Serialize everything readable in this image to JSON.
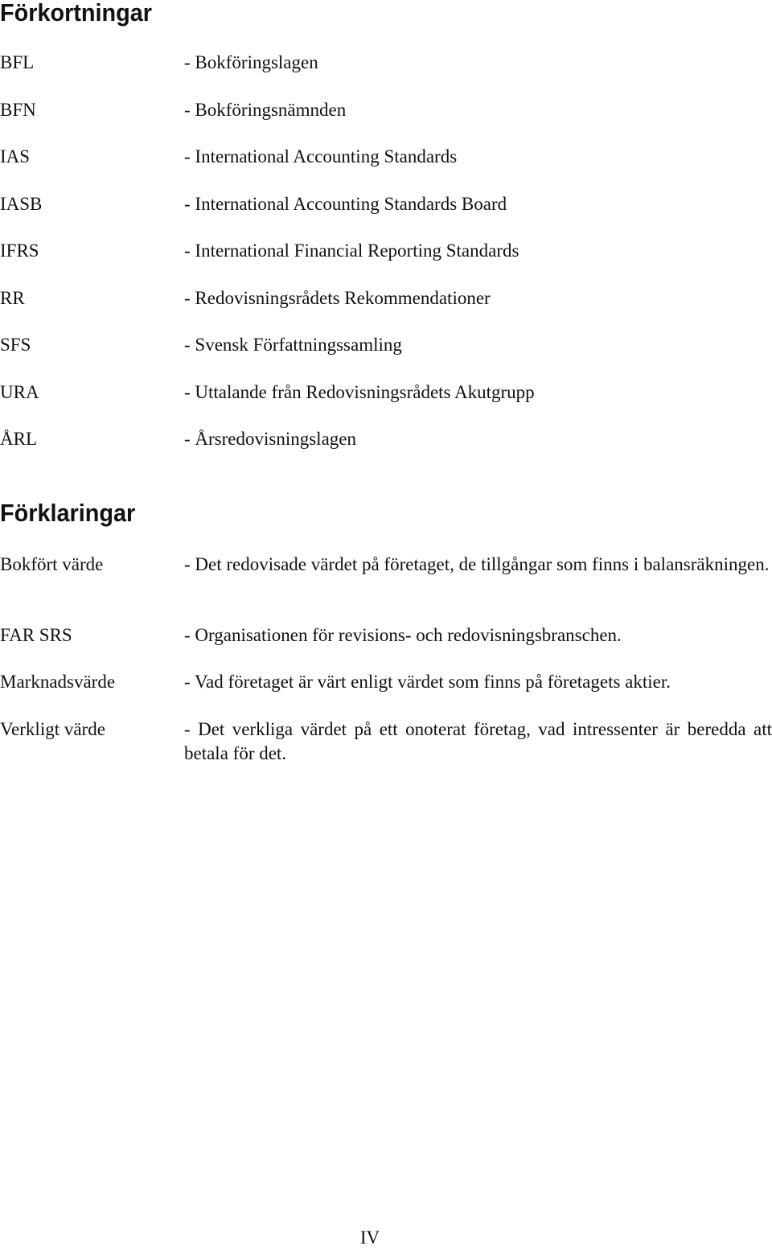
{
  "abbreviations": {
    "heading": "Förkortningar",
    "items": [
      {
        "term": "BFL",
        "description": "- Bokföringslagen"
      },
      {
        "term": "BFN",
        "description": "- Bokföringsnämnden"
      },
      {
        "term": "IAS",
        "description": "- International Accounting Standards"
      },
      {
        "term": "IASB",
        "description": "- International Accounting Standards Board"
      },
      {
        "term": "IFRS",
        "description": "- International Financial Reporting Standards"
      },
      {
        "term": "RR",
        "description": "- Redovisningsrådets Rekommendationer"
      },
      {
        "term": "SFS",
        "description": "- Svensk Författningssamling"
      },
      {
        "term": "URA",
        "description": "- Uttalande från Redovisningsrådets Akutgrupp"
      },
      {
        "term": "ÅRL",
        "description": "- Årsredovisningslagen"
      }
    ]
  },
  "definitions": {
    "heading": "Förklaringar",
    "items": [
      {
        "term": "Bokfört värde",
        "description": "- Det redovisade värdet på företaget, de tillgångar som finns i balansräkningen."
      },
      {
        "term": "FAR SRS",
        "description": "- Organisationen för revisions- och redovisningsbranschen."
      },
      {
        "term": "Marknadsvärde",
        "description": "- Vad företaget är värt enligt värdet som finns på företagets aktier."
      },
      {
        "term": "Verkligt värde",
        "description": "- Det verkliga värdet på ett onoterat företag, vad intressenter är beredda att betala för det."
      }
    ]
  },
  "footer": {
    "page_number": "IV"
  }
}
